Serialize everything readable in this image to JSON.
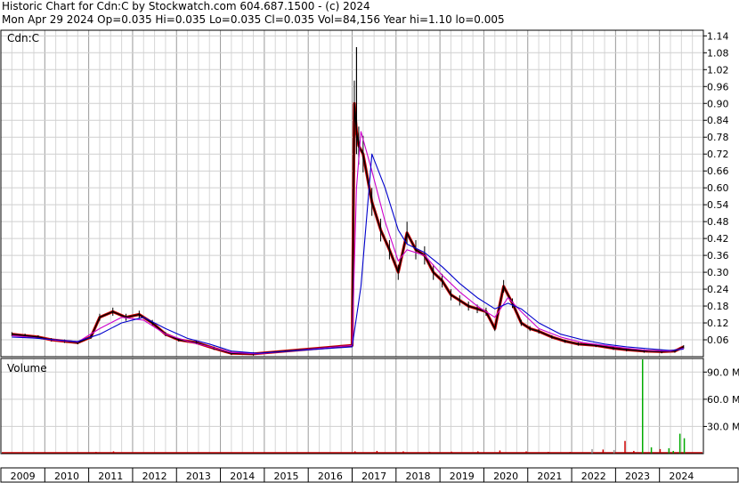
{
  "header": {
    "line1": "Historic Chart for Cdn:C by Stockwatch.com 604.687.1500 - (c) 2024",
    "line2": "Mon Apr 29 2024  Op=0.035  Hi=0.035  Lo=0.035  Cl=0.035  Vol=84,156  Year hi=1.10  lo=0.005"
  },
  "chart_data": [
    {
      "type": "line",
      "title": "",
      "panel_label": "Cdn:C",
      "x_ticks": [
        "2009",
        "2010",
        "2011",
        "2012",
        "2013",
        "2014",
        "2015",
        "2016",
        "2017",
        "2018",
        "2019",
        "2020",
        "2021",
        "2022",
        "2023",
        "2024"
      ],
      "ylim": [
        0.0,
        1.16
      ],
      "y_ticks": [
        "0.06",
        "0.12",
        "0.18",
        "0.24",
        "0.30",
        "0.36",
        "0.42",
        "0.48",
        "0.54",
        "0.60",
        "0.66",
        "0.72",
        "0.78",
        "0.84",
        "0.90",
        "0.96",
        "1.02",
        "1.08",
        "1.14"
      ],
      "grid": true,
      "colors": {
        "price": "#000000",
        "down": "#cc0000",
        "ma_short": "#cc00cc",
        "ma_long": "#0000cc"
      },
      "series": [
        {
          "role": "price",
          "x": [
            2009.0,
            2009.3,
            2009.6,
            2009.9,
            2010.2,
            2010.5,
            2010.8,
            2011.0,
            2011.3,
            2011.6,
            2011.9,
            2012.2,
            2012.5,
            2012.8,
            2013.2,
            2013.6,
            2014.0,
            2014.5,
            2016.75,
            2016.8,
            2016.85,
            2016.9,
            2017.0,
            2017.2,
            2017.4,
            2017.6,
            2017.8,
            2018.0,
            2018.2,
            2018.4,
            2018.6,
            2018.8,
            2019.0,
            2019.2,
            2019.4,
            2019.6,
            2019.8,
            2020.0,
            2020.2,
            2020.4,
            2020.6,
            2020.8,
            2021.0,
            2021.3,
            2021.6,
            2021.9,
            2022.3,
            2022.7,
            2023.0,
            2023.4,
            2023.8,
            2024.1,
            2024.3
          ],
          "y": [
            0.08,
            0.075,
            0.07,
            0.06,
            0.055,
            0.05,
            0.07,
            0.14,
            0.16,
            0.14,
            0.15,
            0.12,
            0.08,
            0.06,
            0.05,
            0.03,
            0.012,
            0.01,
            0.04,
            0.9,
            0.8,
            0.75,
            0.72,
            0.55,
            0.45,
            0.38,
            0.3,
            0.44,
            0.38,
            0.36,
            0.3,
            0.27,
            0.22,
            0.2,
            0.18,
            0.17,
            0.16,
            0.1,
            0.25,
            0.19,
            0.12,
            0.1,
            0.09,
            0.07,
            0.055,
            0.045,
            0.04,
            0.03,
            0.025,
            0.02,
            0.018,
            0.02,
            0.035
          ]
        },
        {
          "role": "ma_short",
          "x": [
            2009.0,
            2009.5,
            2010.0,
            2010.5,
            2011.0,
            2011.5,
            2012.0,
            2012.5,
            2013.0,
            2013.5,
            2014.0,
            2014.6,
            2016.75,
            2016.85,
            2016.95,
            2017.2,
            2017.5,
            2017.8,
            2018.0,
            2018.4,
            2018.8,
            2019.2,
            2019.6,
            2020.0,
            2020.3,
            2020.6,
            2021.0,
            2021.5,
            2022.0,
            2022.5,
            2023.0,
            2023.5,
            2024.0,
            2024.3
          ],
          "y": [
            0.075,
            0.068,
            0.058,
            0.052,
            0.1,
            0.14,
            0.13,
            0.08,
            0.055,
            0.035,
            0.015,
            0.01,
            0.04,
            0.6,
            0.8,
            0.66,
            0.48,
            0.34,
            0.38,
            0.36,
            0.29,
            0.23,
            0.18,
            0.14,
            0.21,
            0.16,
            0.1,
            0.07,
            0.05,
            0.04,
            0.03,
            0.022,
            0.02,
            0.03
          ]
        },
        {
          "role": "ma_long",
          "x": [
            2009.0,
            2009.5,
            2010.0,
            2010.5,
            2011.0,
            2011.5,
            2012.0,
            2012.5,
            2013.0,
            2013.5,
            2014.0,
            2014.6,
            2016.75,
            2016.95,
            2017.2,
            2017.5,
            2017.8,
            2018.0,
            2018.4,
            2018.8,
            2019.2,
            2019.6,
            2020.0,
            2020.3,
            2020.6,
            2021.0,
            2021.5,
            2022.0,
            2022.5,
            2023.0,
            2023.5,
            2024.0,
            2024.3
          ],
          "y": [
            0.07,
            0.066,
            0.06,
            0.054,
            0.08,
            0.12,
            0.14,
            0.1,
            0.065,
            0.045,
            0.02,
            0.012,
            0.035,
            0.25,
            0.72,
            0.6,
            0.45,
            0.4,
            0.37,
            0.32,
            0.26,
            0.21,
            0.17,
            0.19,
            0.17,
            0.12,
            0.08,
            0.06,
            0.045,
            0.035,
            0.028,
            0.022,
            0.027
          ]
        }
      ]
    },
    {
      "type": "bar",
      "title": "",
      "panel_label": "Volume",
      "ylim": [
        0,
        105
      ],
      "y_ticks": [
        "30.0 M",
        "60.0 M",
        "90.0 M"
      ],
      "x": [
        2009.2,
        2009.7,
        2010.3,
        2010.9,
        2011.3,
        2011.8,
        2012.4,
        2013.0,
        2013.7,
        2014.4,
        2016.8,
        2017.3,
        2017.9,
        2018.5,
        2019.0,
        2019.6,
        2020.1,
        2020.7,
        2021.2,
        2021.7,
        2022.2,
        2022.45,
        2022.7,
        2022.95,
        2023.15,
        2023.35,
        2023.55,
        2023.75,
        2023.95,
        2024.05,
        2024.2,
        2024.3
      ],
      "values": [
        1.5,
        1.2,
        1.0,
        2.0,
        2.5,
        1.5,
        1.0,
        0.8,
        0.6,
        0.5,
        2.5,
        3.0,
        2.5,
        2.0,
        2.2,
        2.5,
        3.5,
        2.5,
        2.0,
        1.8,
        5.0,
        4.5,
        4.0,
        14.0,
        3.0,
        104.0,
        7.0,
        5.0,
        6.0,
        3.0,
        22.0,
        17.0
      ],
      "bar_colors": [
        "#cc0000",
        "#cc0000",
        "#cc0000",
        "#cc0000",
        "#cc0000",
        "#cc0000",
        "#cc0000",
        "#cc0000",
        "#cc0000",
        "#cc0000",
        "#cc0000",
        "#cc0000",
        "#cc0000",
        "#cc0000",
        "#cc0000",
        "#cc0000",
        "#cc0000",
        "#cc0000",
        "#cc0000",
        "#cc0000",
        "#999999",
        "#cc0000",
        "#999999",
        "#cc0000",
        "#cc0000",
        "#00aa00",
        "#00aa00",
        "#cc0000",
        "#00aa00",
        "#00aa00",
        "#00aa00",
        "#00aa00"
      ]
    }
  ]
}
